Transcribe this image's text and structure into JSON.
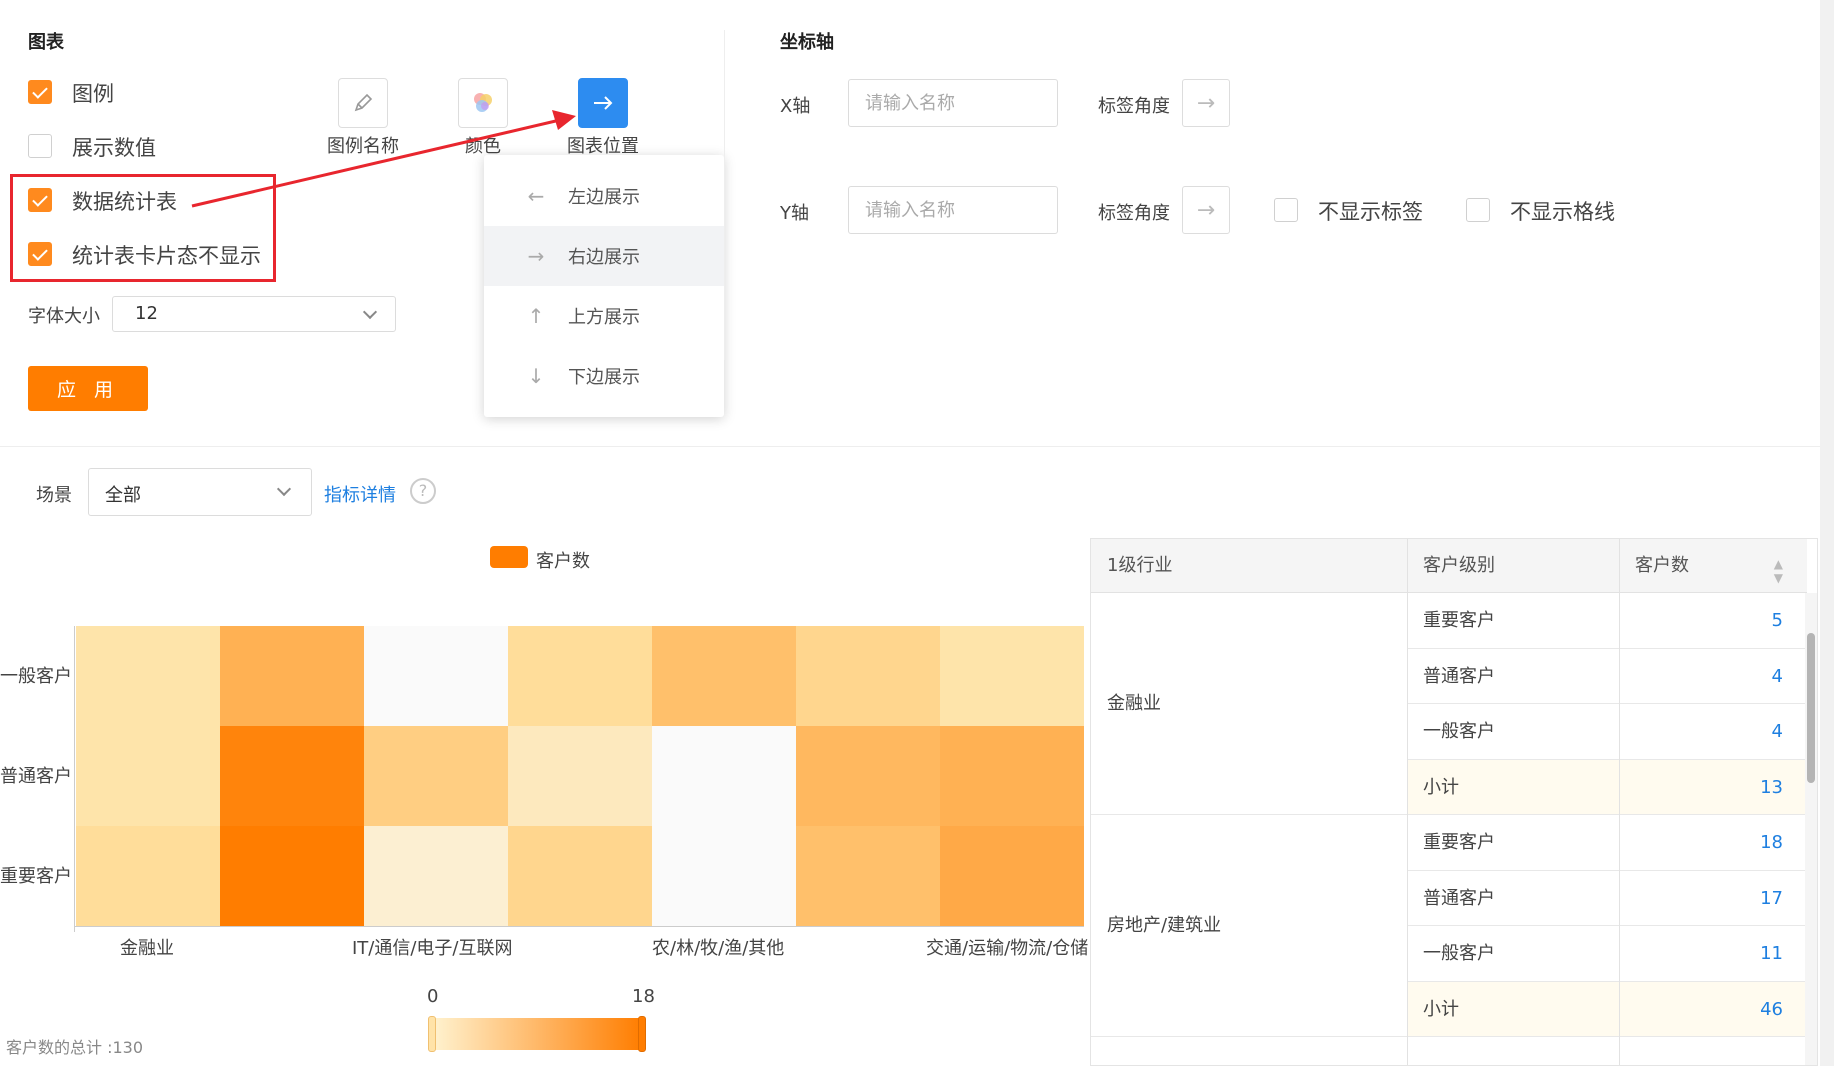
{
  "chart_section": {
    "title": "图表",
    "checkboxes": [
      {
        "label": "图例",
        "checked": true
      },
      {
        "label": "展示数值",
        "checked": false
      },
      {
        "label": "数据统计表",
        "checked": true
      },
      {
        "label": "统计表卡片态不显示",
        "checked": true
      }
    ],
    "tools": [
      {
        "label": "图例名称",
        "icon": "pencil-icon"
      },
      {
        "label": "颜色",
        "icon": "palette-icon"
      },
      {
        "label": "图表位置",
        "icon": "arrow-right-icon"
      }
    ],
    "font_size_label": "字体大小",
    "font_size_value": "12",
    "apply_label": "应 用"
  },
  "position_menu": {
    "items": [
      {
        "label": "左边展示",
        "icon": "arrow-left-icon",
        "glyph": "←"
      },
      {
        "label": "右边展示",
        "icon": "arrow-right-icon",
        "glyph": "→"
      },
      {
        "label": "上方展示",
        "icon": "arrow-up-icon",
        "glyph": "↑"
      },
      {
        "label": "下边展示",
        "icon": "arrow-down-icon",
        "glyph": "↓"
      }
    ]
  },
  "axis_section": {
    "title": "坐标轴",
    "x_label": "X轴",
    "y_label": "Y轴",
    "name_placeholder": "请输入名称",
    "angle_label": "标签角度",
    "hide_labels": "不显示标签",
    "hide_gridlines": "不显示格线"
  },
  "filter": {
    "scene_label": "场景",
    "scene_value": "全部",
    "detail_link": "指标详情",
    "help_glyph": "?"
  },
  "chart_data": {
    "type": "heatmap",
    "legend": "客户数",
    "y_categories": [
      "一般客户",
      "普通客户",
      "重要客户"
    ],
    "x_tick_labels": [
      "金融业",
      "IT/通信/电子/互联网",
      "农/林/牧/渔/其他",
      "交通/运输/物流/仓储"
    ],
    "visual_map": {
      "min": 0,
      "max": 18,
      "min_label": "0",
      "max_label": "18"
    },
    "values": [
      [
        4,
        11,
        0,
        5,
        9,
        6,
        4
      ],
      [
        4,
        17,
        7,
        3,
        0,
        10,
        11
      ],
      [
        5,
        18,
        2,
        6,
        0,
        9,
        12
      ]
    ],
    "total_text": "客户数的总计 :130"
  },
  "table": {
    "columns": [
      "1级行业",
      "客户级别",
      "客户数"
    ],
    "groups": [
      {
        "industry": "金融业",
        "rows": [
          {
            "level": "重要客户",
            "count": "5"
          },
          {
            "level": "普通客户",
            "count": "4"
          },
          {
            "level": "一般客户",
            "count": "4"
          },
          {
            "level": "小计",
            "count": "13",
            "subtotal": true
          }
        ]
      },
      {
        "industry": "房地产/建筑业",
        "rows": [
          {
            "level": "重要客户",
            "count": "18"
          },
          {
            "level": "普通客户",
            "count": "17"
          },
          {
            "level": "一般客户",
            "count": "11"
          },
          {
            "level": "小计",
            "count": "46",
            "subtotal": true
          }
        ]
      }
    ]
  },
  "colors": {
    "accent": "#ff7d00",
    "primary": "#2d8cf0",
    "annotation": "#e8262e",
    "link": "#1e7fe0"
  }
}
